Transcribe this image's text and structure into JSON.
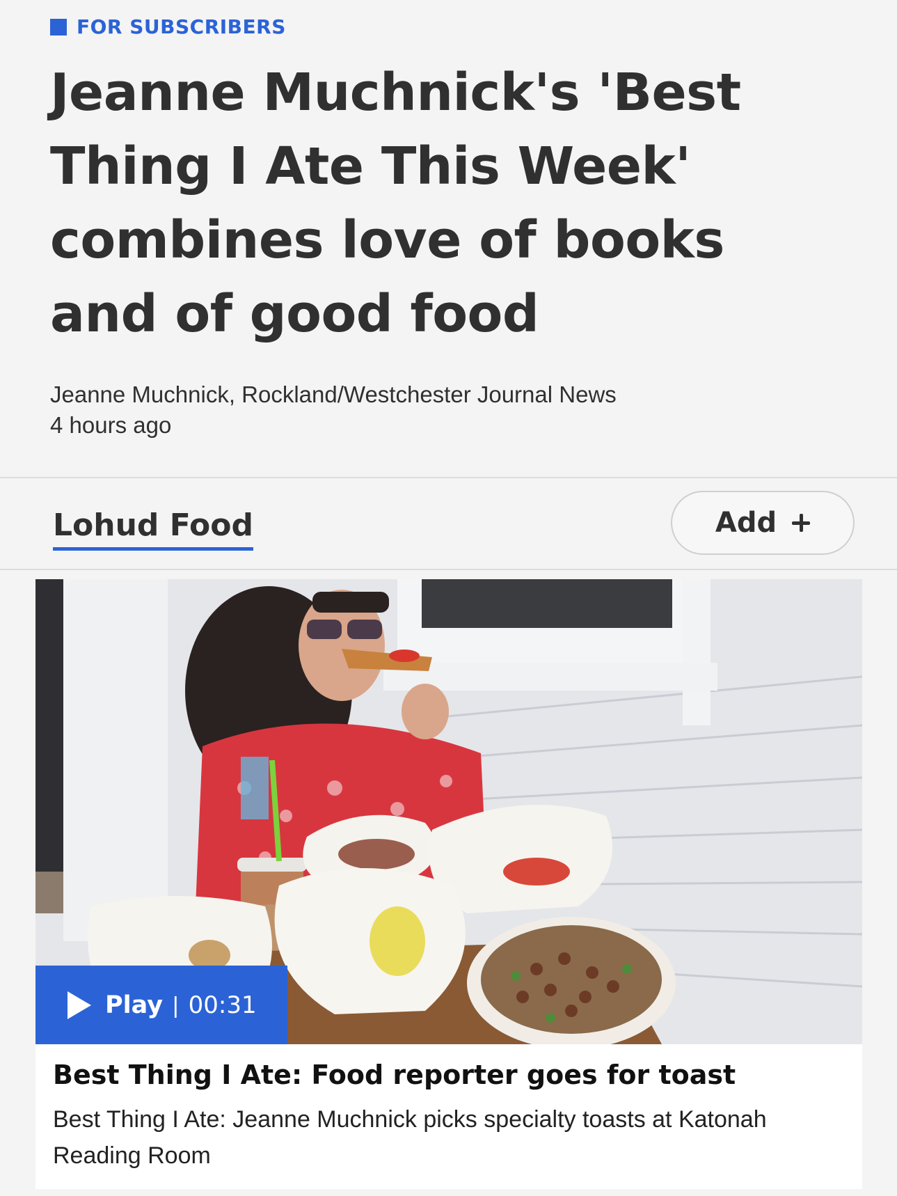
{
  "kicker": {
    "label": "FOR SUBSCRIBERS",
    "color": "#2b63d6"
  },
  "article": {
    "headline": "Jeanne Muchnick's 'Best Thing I Ate This Week' combines love of books and of good food",
    "byline": "Jeanne Muchnick, Rockland/Westchester Journal News",
    "timestamp": "4 hours ago"
  },
  "topic": {
    "label": "Lohud Food",
    "add_label": "Add",
    "add_icon": "plus-icon"
  },
  "video": {
    "play_label": "Play",
    "separator": "|",
    "duration": "00:31",
    "title": "Best Thing I Ate: Food reporter goes for toast",
    "description": "Best Thing I Ate: Jeanne Muchnick picks specialty toasts at Katonah Reading Room",
    "thumbnail_alt": "Woman in red floral top eating toast at outdoor table with food baskets"
  },
  "colors": {
    "accent": "#2b63d6",
    "text": "#303030",
    "background": "#f4f4f4"
  }
}
